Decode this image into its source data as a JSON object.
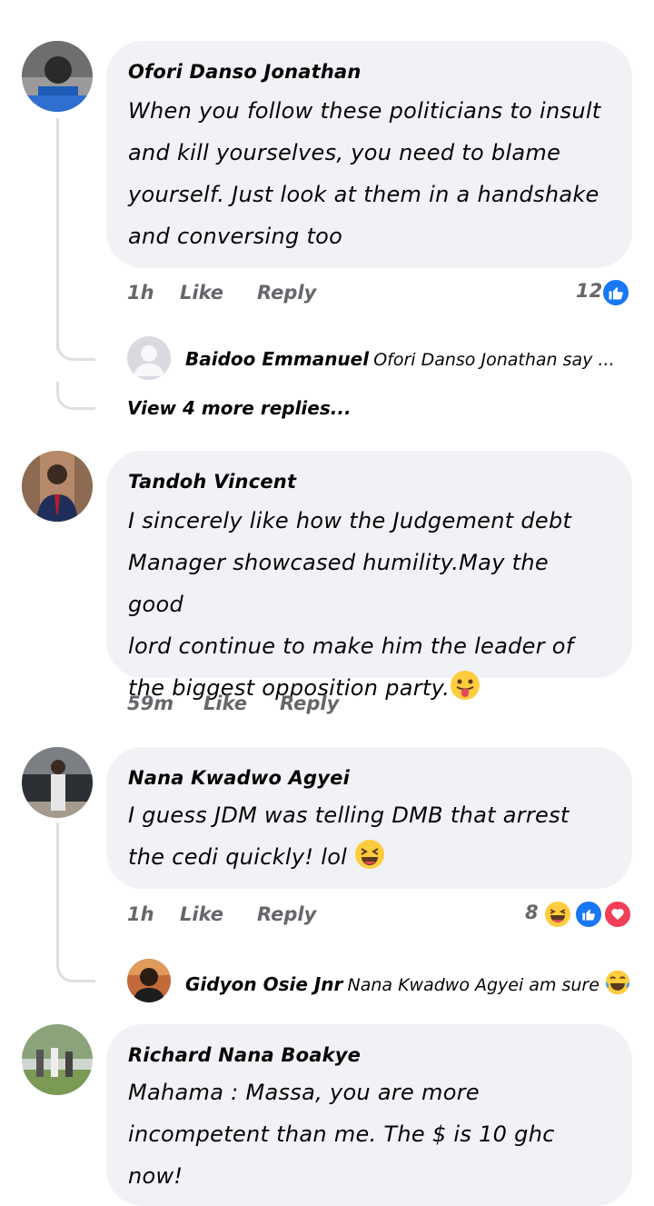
{
  "comments": [
    {
      "author": "Ofori Danso Jonathan",
      "lines": [
        "When you follow these politicians to insult",
        "and kill yourselves, you need to blame",
        "yourself. Just look at them in a handshake",
        "and conversing too"
      ],
      "time": "1h",
      "like_label": "Like",
      "reply_label": "Reply",
      "reaction_count": "12",
      "reply_preview": {
        "author": "Baidoo Emmanuel",
        "text": "Ofori Danso Jonathan say ..."
      },
      "view_more": "View 4 more replies..."
    },
    {
      "author": "Tandoh Vincent",
      "lines": [
        "I sincerely like how the Judgement debt",
        "Manager showcased humility.May the good",
        "lord continue to make him the leader of",
        "the biggest opposition party."
      ],
      "time": "59m",
      "like_label": "Like",
      "reply_label": "Reply"
    },
    {
      "author": "Nana Kwadwo Agyei",
      "lines": [
        "I guess JDM was telling DMB that arrest",
        "the cedi quickly! lol"
      ],
      "time": "1h",
      "like_label": "Like",
      "reply_label": "Reply",
      "reaction_count": "8",
      "reply_preview": {
        "author": "Gidyon Osie Jnr",
        "text": "Nana Kwadwo Agyei am sure"
      }
    },
    {
      "author": "Richard Nana Boakye",
      "lines": [
        "Mahama : Massa, you are more",
        "incompetent than me. The $ is 10 ghc now!"
      ]
    }
  ],
  "colors": {
    "bubble": "#f0f2f5",
    "like_blue": "#1877f2",
    "love_red": "#f33e58",
    "meta_gray": "#65676b"
  },
  "icons": [
    "like-reaction-icon",
    "haha-reaction-icon",
    "love-reaction-icon",
    "tongue-out-emoji",
    "laughing-emoji",
    "tears-of-joy-emoji",
    "default-avatar-icon"
  ]
}
